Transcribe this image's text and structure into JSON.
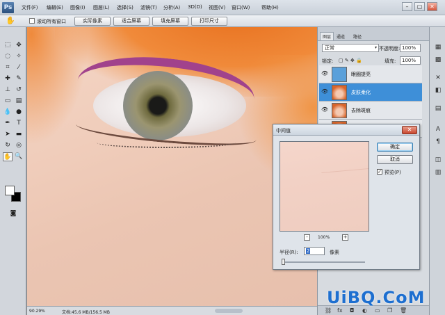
{
  "app": {
    "logo": "Ps"
  },
  "menu": [
    "文件(F)",
    "编辑(E)",
    "图像(I)",
    "图层(L)",
    "选择(S)",
    "滤镜(T)",
    "分析(A)",
    "3D(D)",
    "视图(V)",
    "窗口(W)",
    "帮助(H)"
  ],
  "window_controls": {
    "minimize": "–",
    "maximize": "▢",
    "close": "✕"
  },
  "options": {
    "scroll_all_label": "滚动所有窗口",
    "btn1": "实际像素",
    "btn2": "适合屏幕",
    "btn3": "填充屏幕",
    "btn4": "打印尺寸"
  },
  "status": {
    "zoom": "90.29%",
    "docinfo": "文档:45.6 MB/156.5 MB"
  },
  "layers_panel": {
    "tabs": [
      "图层",
      "通道",
      "路径"
    ],
    "blend_mode": "正常",
    "opacity_label": "不透明度:",
    "opacity": "100%",
    "lock_label": "锁定:",
    "fill_label": "填充:",
    "fill": "100%",
    "layers": [
      {
        "name": "眼圈提亮",
        "selected": false
      },
      {
        "name": "皮肤柔化",
        "selected": true
      },
      {
        "name": "去除斑痕",
        "selected": false
      },
      {
        "name": "",
        "selected": false
      }
    ]
  },
  "dialog": {
    "title": "中间值",
    "close": "✕",
    "ok": "确定",
    "cancel": "取消",
    "preview_label": "预览(P)",
    "preview_check": "✓",
    "zoom_minus": "-",
    "zoom_plus": "+",
    "zoom_pct": "100%",
    "radius_label": "半径(R):",
    "radius_value": "2",
    "unit": "像素"
  },
  "watermark": "UiBQ.CoM"
}
